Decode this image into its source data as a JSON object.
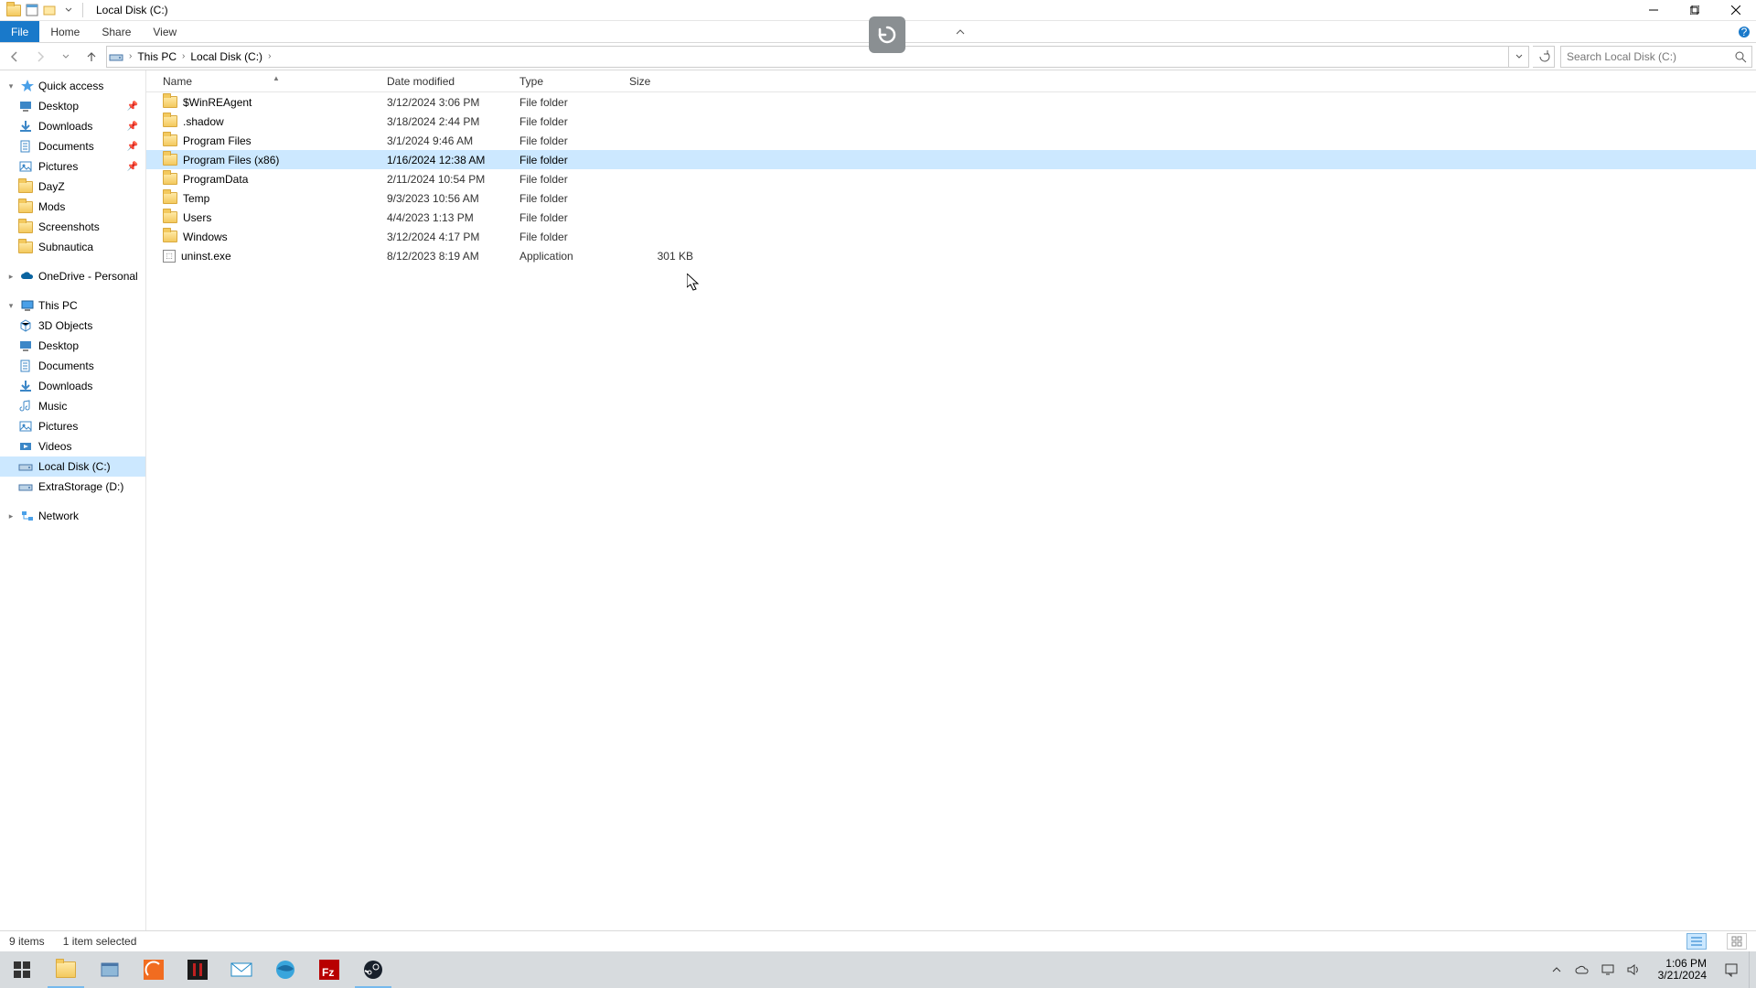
{
  "window": {
    "title": "Local Disk (C:)"
  },
  "ribbon": {
    "file": "File",
    "home": "Home",
    "share": "Share",
    "view": "View"
  },
  "breadcrumb": {
    "root": "This PC",
    "location": "Local Disk (C:)"
  },
  "search": {
    "placeholder": "Search Local Disk (C:)"
  },
  "nav": {
    "quick_access": {
      "label": "Quick access",
      "items": [
        {
          "label": "Desktop",
          "pinned": true,
          "icon": "desktop"
        },
        {
          "label": "Downloads",
          "pinned": true,
          "icon": "downloads"
        },
        {
          "label": "Documents",
          "pinned": true,
          "icon": "documents"
        },
        {
          "label": "Pictures",
          "pinned": true,
          "icon": "pictures"
        },
        {
          "label": "DayZ",
          "pinned": false,
          "icon": "folder"
        },
        {
          "label": "Mods",
          "pinned": false,
          "icon": "folder"
        },
        {
          "label": "Screenshots",
          "pinned": false,
          "icon": "folder"
        },
        {
          "label": "Subnautica",
          "pinned": false,
          "icon": "folder"
        }
      ]
    },
    "onedrive": {
      "label": "OneDrive - Personal"
    },
    "this_pc": {
      "label": "This PC",
      "items": [
        {
          "label": "3D Objects",
          "icon": "3d"
        },
        {
          "label": "Desktop",
          "icon": "desktop"
        },
        {
          "label": "Documents",
          "icon": "documents"
        },
        {
          "label": "Downloads",
          "icon": "downloads"
        },
        {
          "label": "Music",
          "icon": "music"
        },
        {
          "label": "Pictures",
          "icon": "pictures"
        },
        {
          "label": "Videos",
          "icon": "videos"
        },
        {
          "label": "Local Disk (C:)",
          "icon": "drive",
          "selected": true
        },
        {
          "label": "ExtraStorage (D:)",
          "icon": "drive"
        }
      ]
    },
    "network": {
      "label": "Network"
    }
  },
  "columns": {
    "name": "Name",
    "date": "Date modified",
    "type": "Type",
    "size": "Size"
  },
  "files": [
    {
      "name": "$WinREAgent",
      "date": "3/12/2024 3:06 PM",
      "type": "File folder",
      "size": "",
      "kind": "folder"
    },
    {
      "name": ".shadow",
      "date": "3/18/2024 2:44 PM",
      "type": "File folder",
      "size": "",
      "kind": "folder"
    },
    {
      "name": "Program Files",
      "date": "3/1/2024 9:46 AM",
      "type": "File folder",
      "size": "",
      "kind": "folder"
    },
    {
      "name": "Program Files (x86)",
      "date": "1/16/2024 12:38 AM",
      "type": "File folder",
      "size": "",
      "kind": "folder",
      "selected": true
    },
    {
      "name": "ProgramData",
      "date": "2/11/2024 10:54 PM",
      "type": "File folder",
      "size": "",
      "kind": "folder"
    },
    {
      "name": "Temp",
      "date": "9/3/2023 10:56 AM",
      "type": "File folder",
      "size": "",
      "kind": "folder"
    },
    {
      "name": "Users",
      "date": "4/4/2023 1:13 PM",
      "type": "File folder",
      "size": "",
      "kind": "folder"
    },
    {
      "name": "Windows",
      "date": "3/12/2024 4:17 PM",
      "type": "File folder",
      "size": "",
      "kind": "folder"
    },
    {
      "name": "uninst.exe",
      "date": "8/12/2023 8:19 AM",
      "type": "Application",
      "size": "301 KB",
      "kind": "app"
    }
  ],
  "status": {
    "count": "9 items",
    "selection": "1 item selected"
  },
  "taskbar": {
    "time": "1:06 PM",
    "date": "3/21/2024"
  },
  "colors": {
    "accent": "#1979ca",
    "selection": "#cce8ff"
  }
}
